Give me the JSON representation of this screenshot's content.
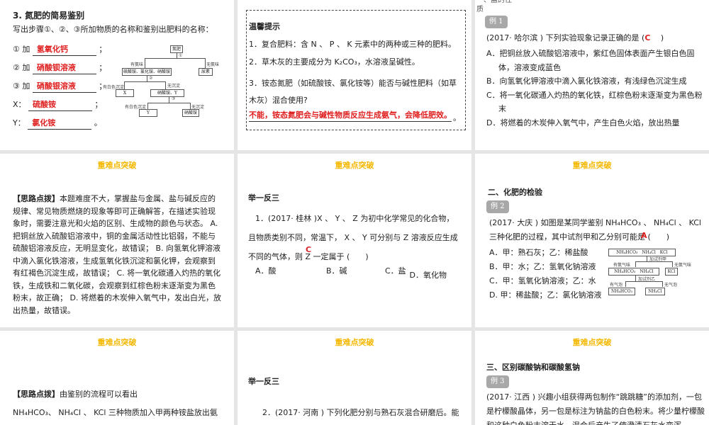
{
  "header": "重难点突破",
  "s1": {
    "title": "3. 氮肥的简易鉴别",
    "instr": "写出步骤①、②、③所加物质的名称和鉴别出肥料的名称：",
    "rows": [
      {
        "label": "① 加",
        "answer": "氢氧化钙",
        "end": "；"
      },
      {
        "label": "② 加",
        "answer": "硝酸钡溶液",
        "end": "；"
      },
      {
        "label": "③ 加",
        "answer": "硝酸银溶液",
        "end": "；"
      },
      {
        "label": "X：",
        "answer": "硫酸铵",
        "end": "；"
      },
      {
        "label": "Y：",
        "answer": "氯化铵",
        "end": "。"
      }
    ],
    "diagram": {
      "root": "氮肥",
      "step1": "①",
      "left1": "有氨味",
      "right1": "无氨味",
      "group": "硫酸铵、氯化铵、硝酸铵",
      "urea": "尿素",
      "step2": "②",
      "left2": "有白色沉淀",
      "right2": "无沉淀",
      "x": "X",
      "mid": "硝酸铵、Y",
      "step3": "③",
      "left3": "有白色沉淀",
      "right3": "无沉淀",
      "y": "Y",
      "nitrate": "硝酸铵"
    }
  },
  "s2": {
    "title": "温馨提示",
    "l1": "1．复合肥料：含 N 、 P 、 K 元素中的两种或三种的肥料。",
    "l2": "2．草木灰的主要成分为 K₂CO₃，水溶液呈碱性。",
    "l3": "3．铵态氮肥（如硫酸铵、氯化铵等）能否与碱性肥料（如草木灰）混合使用?",
    "answer": "不能，铵态氮肥会与碱性物质反应生成氨气，会降低肥效。",
    "end": "。"
  },
  "s3": {
    "section": "一、盐的性质",
    "badge": "例 1",
    "q": "(2017· 哈尔滨 ) 下列实验现象记录正确的是 (",
    "mark": "C",
    "qend": "　 )",
    "opts": [
      "A．把铜丝放入硫酸铝溶液中，紫红色固体表面产生银白色固体，溶液变成蓝色",
      "B．向氢氧化钾溶液中滴入氯化铁溶液，有浅绿色沉淀生成",
      "C．将一氧化碳通入灼热的氧化铁，红棕色粉末逐渐变为黑色粉末",
      "D．将燃着的木炭伸入氧气中，产生白色火焰，放出热量"
    ]
  },
  "s4": {
    "tag": "【思路点拨】",
    "text": "本题难度不大，掌握盐与金属、盐与碱反应的规律、常见物质燃烧的现象等即可正确解答，在描述实验现象时，需要注意光和火焰的区别、生成物的颜色与状态。 A. 把铜丝放入硫酸铝溶液中，铜的金属活动性比铝弱，不能与硫酸铝溶液反应，无明显变化，故错误； B. 向氢氧化钾溶液中滴入氯化铁溶液，生成氢氧化铁沉淀和氯化钾，会观察到有红褐色沉淀生成，故错误； C. 将一氧化碳通入灼热的氧化铁，生成铁和二氧化碳，会观察到红棕色粉末逐渐变为黑色粉末，故正确； D. 将燃着的木炭伸入氧气中，发出白光，放出热量，故错误。"
  },
  "s5": {
    "title": "举一反三",
    "q": "1．(2017· 桂林 )X 、 Y 、 Z 为初中化学常见的化合物，且物质类别不同，常温下， X 、 Y 可分别与 Z 溶液反应生成不同的气体，则 Z 一定属于 (　　)",
    "mark": "C",
    "opts": [
      "A．酸",
      "B．碱",
      "C．盐",
      "D．氧化物"
    ]
  },
  "s6": {
    "section": "二、化肥的检验",
    "badge": "例 2",
    "q": "(2017· 大庆 ) 如图是某同学鉴别 NH₄HCO₃ 、 NH₄Cl 、 KCl 三种化肥的过程，其中试剂甲和乙分别可能是 (　　)",
    "mark": "A",
    "opts": [
      "A．甲：熟石灰；乙：稀盐酸",
      "B．甲：水；乙：氢氧化钠溶液",
      "C．甲：氢氧化钠溶液；乙：水",
      "D. 甲：稀盐酸；乙：氯化钠溶液"
    ],
    "diagram": {
      "top": "NH₄HCO₃　NH₄Cl　KCl",
      "reag1": "加试剂甲",
      "l1": "有氨气味",
      "r1": "无氨气味",
      "mid": "NH₄HCO₃　NH₄Cl",
      "kcl": "KCl",
      "reag2": "加试剂乙",
      "l2": "有气泡",
      "r2": "无气泡",
      "b1": "NH₄HCO₃",
      "b2": "NH₄Cl"
    }
  },
  "s7": {
    "tag": "【思路点拨】",
    "text": "由鉴别的流程可以看出",
    "text2": "NH₄HCO₃、 NH₄Cl 、 KCl 三种物质加入甲两种铵盐放出氨"
  },
  "s8": {
    "title": "举一反三",
    "q": "2．(2017· 河南 ) 下列化肥分别与熟石灰混合研磨后。能"
  },
  "s9": {
    "section": "三、区别碳酸钠和碳酸氢钠",
    "badge": "例 3",
    "q": "(2017· 江西 ) 兴趣小组获得两包制作“跳跳糖”的添加剂，一包是柠檬酸晶体，另一包是标注为钠盐的白色粉末。将少量柠檬酸和这种白色粉末溶于水，混合后产生了使澄清石灰水变浑"
  }
}
